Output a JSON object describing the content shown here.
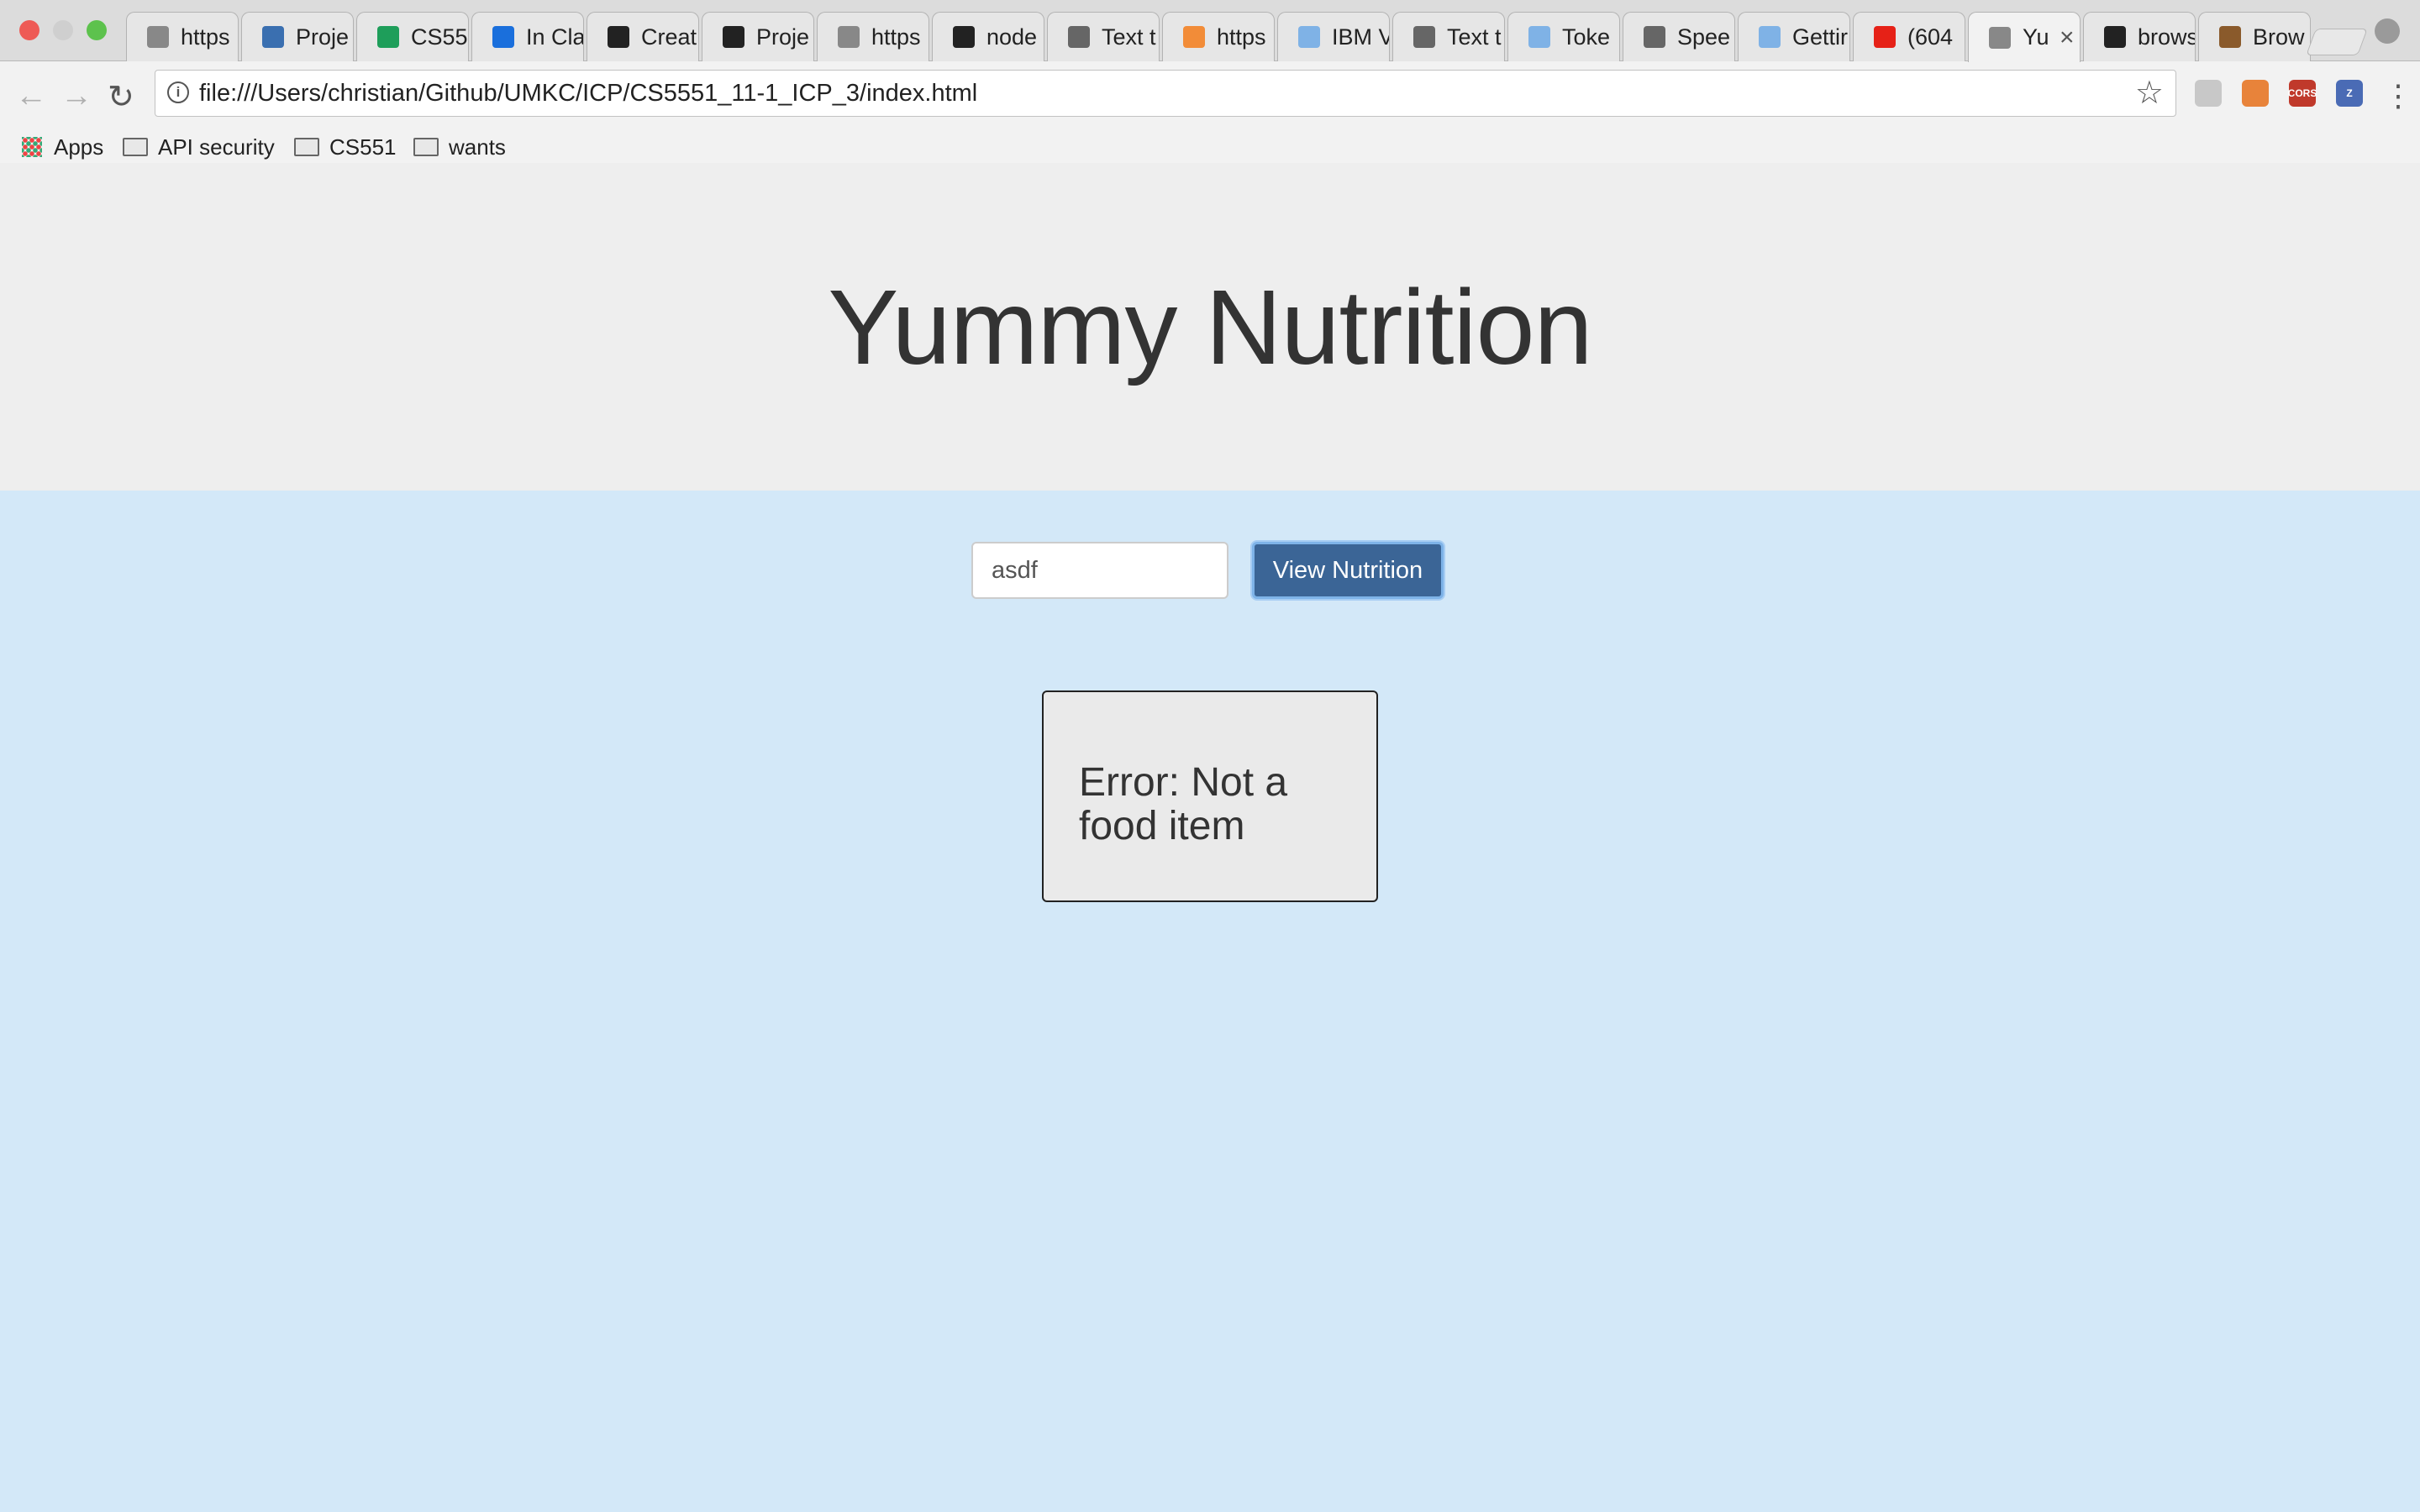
{
  "browser": {
    "tabs": [
      {
        "title": "https",
        "icon": "document-icon",
        "color": "#888888"
      },
      {
        "title": "Proje",
        "icon": "umkc-icon",
        "color": "#3a6fb0"
      },
      {
        "title": "CS55",
        "icon": "sheets-icon",
        "color": "#1e9e5a"
      },
      {
        "title": "In Cla",
        "icon": "box-icon",
        "color": "#1a6fdc"
      },
      {
        "title": "Creat",
        "icon": "github-icon",
        "color": "#222222"
      },
      {
        "title": "Proje",
        "icon": "github-icon",
        "color": "#222222"
      },
      {
        "title": "https",
        "icon": "document-icon",
        "color": "#888888"
      },
      {
        "title": "node",
        "icon": "github-icon",
        "color": "#222222"
      },
      {
        "title": "Text t",
        "icon": "watson-icon",
        "color": "#666666"
      },
      {
        "title": "https",
        "icon": "dots-icon",
        "color": "#f28c38"
      },
      {
        "title": "IBM V",
        "icon": "cloud-icon",
        "color": "#7fb2e6"
      },
      {
        "title": "Text t",
        "icon": "watson-icon",
        "color": "#666666"
      },
      {
        "title": "Toke",
        "icon": "cloud-icon",
        "color": "#7fb2e6"
      },
      {
        "title": "Spee",
        "icon": "watson-icon",
        "color": "#666666"
      },
      {
        "title": "Gettir",
        "icon": "cloud-icon",
        "color": "#7fb2e6"
      },
      {
        "title": "(604",
        "icon": "youtube-icon",
        "color": "#e62117"
      },
      {
        "title": "Yu",
        "icon": "document-icon",
        "color": "#888888",
        "active": true
      },
      {
        "title": "brows",
        "icon": "github-icon",
        "color": "#222222"
      },
      {
        "title": "Brow",
        "icon": "wizard-hat-icon",
        "color": "#8a5a2b"
      }
    ],
    "tab_close": "×",
    "url": "file:///Users/christian/Github/UMKC/ICP/CS5551_11-1_ICP_3/index.html",
    "bookmarks": [
      {
        "label": "Apps",
        "icon": "apps-grid-icon"
      },
      {
        "label": "API security",
        "icon": "folder-icon"
      },
      {
        "label": "CS551",
        "icon": "folder-icon"
      },
      {
        "label": "wants",
        "icon": "folder-icon"
      }
    ],
    "extensions": [
      {
        "icon": "extension-gear-icon",
        "color": "#c8c8c8",
        "text": ""
      },
      {
        "icon": "extension-orange-icon",
        "color": "#e8833a",
        "text": ""
      },
      {
        "icon": "cors-icon",
        "color": "#c0392b",
        "text": "CORS"
      },
      {
        "icon": "zotero-icon",
        "color": "#4a6bb5",
        "text": "Z"
      }
    ]
  },
  "page": {
    "title": "Yummy Nutrition",
    "search": {
      "value": "asdf",
      "button_label": "View Nutrition"
    },
    "result": {
      "message": "Error: Not a food item"
    }
  },
  "colors": {
    "jumbotron_bg": "#eeeeee",
    "content_bg": "#d3e8f8",
    "button_bg": "#3b6596",
    "result_bg": "#eaeaea"
  }
}
